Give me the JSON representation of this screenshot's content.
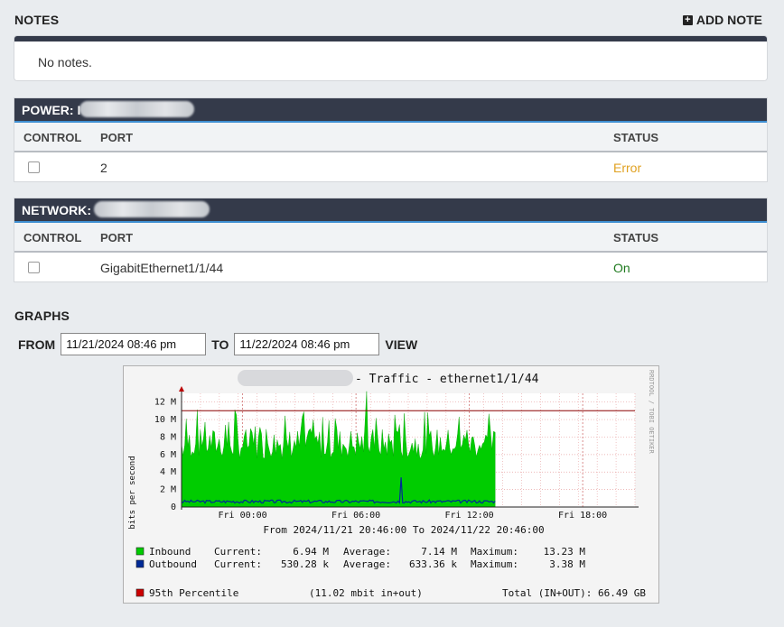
{
  "notes": {
    "title": "NOTES",
    "add_label": "ADD NOTE",
    "empty_text": "No notes."
  },
  "power": {
    "title": "POWER: I",
    "columns": [
      "CONTROL",
      "PORT",
      "STATUS"
    ],
    "rows": [
      {
        "port": "2",
        "status": "Error"
      }
    ]
  },
  "network": {
    "title": "NETWORK:",
    "columns": [
      "CONTROL",
      "PORT",
      "STATUS"
    ],
    "rows": [
      {
        "port": "GigabitEthernet1/1/44",
        "status": "On"
      }
    ]
  },
  "graphs": {
    "title": "GRAPHS",
    "from_label": "FROM",
    "from_value": "11/21/2024 08:46 pm",
    "to_label": "TO",
    "to_value": "11/22/2024 08:46 pm",
    "view_label": "VIEW"
  },
  "chart_data": {
    "type": "area",
    "title": "- Traffic - ethernet1/1/44",
    "ylabel": "bits per second",
    "watermark": "RRDTOOL / TOBI OETIKER",
    "y_ticks": [
      "0",
      "2 M",
      "4 M",
      "6 M",
      "8 M",
      "10 M",
      "12 M"
    ],
    "ylim": [
      0,
      13000000
    ],
    "x_ticks": [
      "Fri 00:00",
      "Fri 06:00",
      "Fri 12:00",
      "Fri 18:00"
    ],
    "range_text": "From 2024/11/21 20:46:00 To 2024/11/22 20:46:00",
    "percentile_value": 11020000,
    "inbound_peak": 13230000,
    "outbound_spike": 3380000,
    "legend": [
      {
        "name": "Inbound",
        "color": "#00cc00",
        "current": "6.94 M",
        "average": "7.14 M",
        "maximum": "13.23 M"
      },
      {
        "name": "Outbound",
        "color": "#002a97",
        "current": "530.28 k",
        "average": "633.36 k",
        "maximum": "3.38 M"
      }
    ],
    "labels": {
      "current": "Current:",
      "average": "Average:",
      "maximum": "Maximum:"
    },
    "percentile": {
      "name": "95th Percentile",
      "color": "#cc0000",
      "detail": "(11.02 mbit in+out)",
      "total": "Total (IN+OUT): 66.49 GB"
    }
  }
}
